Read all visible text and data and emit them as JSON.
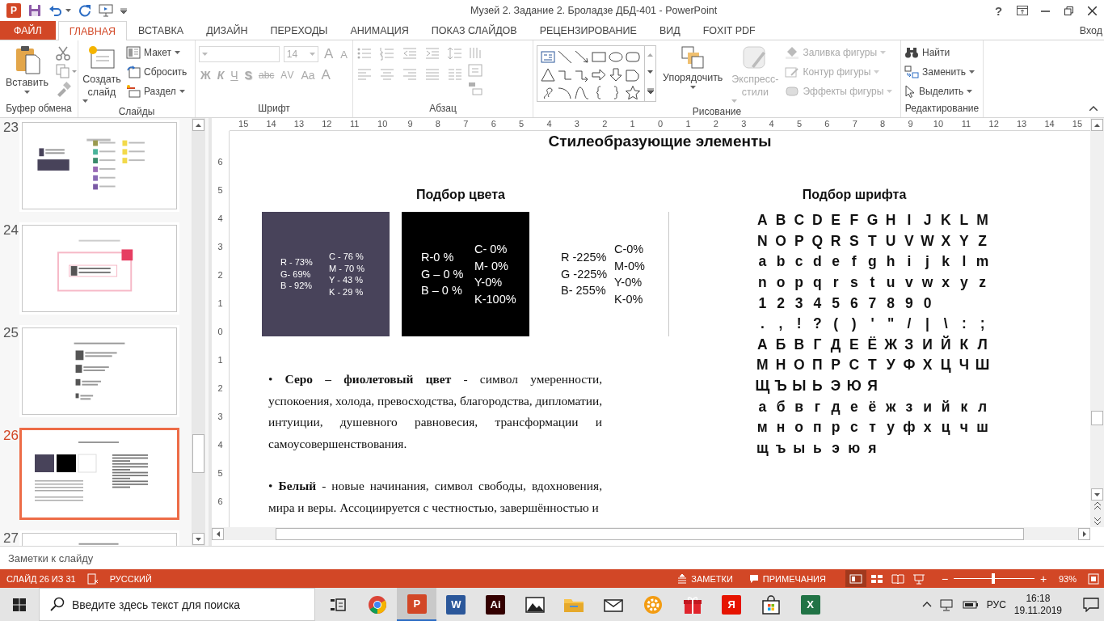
{
  "window": {
    "app_icon": "P",
    "title": "Музей 2. Задание 2. Броладзе ДБД-401 - PowerPoint",
    "help": "?"
  },
  "quick_access": [
    {
      "kind": "save"
    },
    {
      "kind": "undo"
    },
    {
      "kind": "redo"
    },
    {
      "kind": "slideshow"
    },
    {
      "kind": "customize"
    }
  ],
  "tabs": [
    {
      "label": "ФАЙЛ",
      "kind": "file",
      "selected": false
    },
    {
      "label": "ГЛАВНАЯ",
      "kind": "tab",
      "selected": true
    },
    {
      "label": "ВСТАВКА",
      "kind": "tab",
      "selected": false
    },
    {
      "label": "ДИЗАЙН",
      "kind": "tab",
      "selected": false
    },
    {
      "label": "ПЕРЕХОДЫ",
      "kind": "tab",
      "selected": false
    },
    {
      "label": "АНИМАЦИЯ",
      "kind": "tab",
      "selected": false
    },
    {
      "label": "ПОКАЗ СЛАЙДОВ",
      "kind": "tab",
      "selected": false
    },
    {
      "label": "РЕЦЕНЗИРОВАНИЕ",
      "kind": "tab",
      "selected": false
    },
    {
      "label": "ВИД",
      "kind": "tab",
      "selected": false
    },
    {
      "label": "FOXIT PDF",
      "kind": "tab",
      "selected": false
    }
  ],
  "account": "Вход",
  "ribbon": {
    "clipboard": {
      "label": "Буфер обмена",
      "paste": "Вставить"
    },
    "slides": {
      "label": "Слайды",
      "new_slide": "Создать слайд",
      "items": [
        {
          "label": "Макет",
          "kind": "layout",
          "dropdown": true
        },
        {
          "label": "Сбросить",
          "kind": "reset",
          "dropdown": false
        },
        {
          "label": "Раздел",
          "kind": "section",
          "dropdown": true
        }
      ]
    },
    "font": {
      "label": "Шрифт",
      "disabled": true,
      "size": "14",
      "size_buttons": [
        {
          "label": "A",
          "kind": "grow"
        },
        {
          "label": "A",
          "kind": "shrink"
        }
      ],
      "style_buttons": [
        {
          "label": "Ж",
          "kind": "bold"
        },
        {
          "label": "К",
          "kind": "italic"
        },
        {
          "label": "Ч",
          "kind": "underline"
        },
        {
          "label": "S",
          "kind": "shadow"
        },
        {
          "label": "abc",
          "kind": "strike"
        },
        {
          "label": "AV",
          "kind": "spacing"
        },
        {
          "label": "Aa",
          "kind": "case"
        },
        {
          "label": "A",
          "kind": "color"
        }
      ]
    },
    "paragraph": {
      "label": "Абзац",
      "disabled": true
    },
    "drawing": {
      "label": "Рисование",
      "arrange": "Упорядочить",
      "quick_styles": {
        "label": "Экспресс-стили",
        "disabled": true
      },
      "items": [
        {
          "label": "Заливка фигуры",
          "kind": "fill",
          "disabled": true
        },
        {
          "label": "Контур фигуры",
          "kind": "outline",
          "disabled": true
        },
        {
          "label": "Эффекты фигуры",
          "kind": "effects",
          "disabled": true
        }
      ]
    },
    "editing": {
      "label": "Редактирование",
      "items": [
        {
          "label": "Найти",
          "kind": "find",
          "dropdown": false
        },
        {
          "label": "Заменить",
          "kind": "replace",
          "dropdown": true
        },
        {
          "label": "Выделить",
          "kind": "select",
          "dropdown": true
        }
      ]
    }
  },
  "slide_thumbnails": [
    {
      "number": "23",
      "kind": "palette",
      "selected": false
    },
    {
      "number": "24",
      "kind": "logo-frame",
      "selected": false
    },
    {
      "number": "25",
      "kind": "logo-sizes",
      "selected": false
    },
    {
      "number": "26",
      "kind": "style",
      "selected": true
    },
    {
      "number": "27",
      "kind": "document",
      "selected": false
    }
  ],
  "horizontal_ruler": [
    "15",
    "14",
    "13",
    "12",
    "11",
    "10",
    "9",
    "8",
    "7",
    "6",
    "5",
    "4",
    "3",
    "2",
    "1",
    "0",
    "1",
    "2",
    "3",
    "4",
    "5",
    "6",
    "7",
    "8",
    "9",
    "10",
    "11",
    "12",
    "13",
    "14",
    "15"
  ],
  "vertical_ruler": [
    "6",
    "5",
    "4",
    "3",
    "2",
    "1",
    "0",
    "1",
    "2",
    "3",
    "4",
    "5",
    "6"
  ],
  "slide": {
    "title": "Стилеобразующие элементы",
    "color_section": {
      "heading": "Подбор цвета",
      "swatches": [
        {
          "kind": "dark",
          "color": "#48435a",
          "compact": true,
          "rgb": [
            "R - 73%",
            "G- 69%",
            "B - 92%"
          ],
          "cmyk": [
            "C - 76 %",
            "M - 70 %",
            "Y - 43 %",
            "K - 29 %"
          ]
        },
        {
          "kind": "dark",
          "color": "#000000",
          "compact": false,
          "rgb": [
            "R-0 %",
            "G – 0 %",
            "B – 0 %"
          ],
          "cmyk": [
            "C- 0%",
            "M- 0%",
            "Y-0%",
            "K-100%"
          ]
        },
        {
          "kind": "light",
          "color": "#ffffff",
          "compact": false,
          "rgb": [
            "R -225%",
            "G -225%",
            "B- 255%"
          ],
          "cmyk": [
            "C-0%",
            "M-0%",
            "Y-0%",
            "K-0%"
          ]
        }
      ]
    },
    "paragraphs": [
      "• **Серо – фиолетовый цвет** -  символ умеренности, успокоения, холода, превосходства, благородства, дипломатии, интуиции, душевного равновесия, трансформации и самоусовершенствования.",
      "• **Белый** - новые начинания, символ свободы, вдохновения, мира и веры. Ассоциируется с честностью, завершённостью и"
    ],
    "font_section": {
      "heading": "Подбор шрифта",
      "rows": [
        "A B C D E F G H I J K L M",
        "N O P Q R S T U V W X Y Z",
        "a b c d e f g h i j k l m",
        "n o p q r s t u v w x y z",
        "1 2 3 4 5 6 7 8 9 0",
        ". , ! ? ( ) ' \" / | \\ : ;",
        "А Б В Г Д Е Ё Ж З И Й К Л",
        "М Н О П Р С Т У Ф Х Ц Ч Ш",
        "Щ Ъ Ы Ь Э Ю Я",
        "а б в г д е ё ж з и й к л",
        "м н о п р с т у ф х ц ч ш",
        "щ ъ ы ь э ю я"
      ]
    }
  },
  "notes": {
    "placeholder": "Заметки к слайду"
  },
  "status": {
    "slide": "СЛАЙД 26 ИЗ 31",
    "language": "РУССКИЙ",
    "notes": "ЗАМЕТКИ",
    "comments": "ПРИМЕЧАНИЯ",
    "views": [
      {
        "kind": "normal",
        "selected": true
      },
      {
        "kind": "sorter",
        "selected": false
      },
      {
        "kind": "reading",
        "selected": false
      },
      {
        "kind": "slideshow",
        "selected": false
      }
    ],
    "zoom_out": "−",
    "zoom": {
      "level": 0.49
    },
    "zoom_in": "+",
    "zoom_value": "93%"
  },
  "taskbar": {
    "search": {
      "placeholder": "Введите здесь текст для поиска"
    },
    "apps": [
      {
        "kind": "task-view",
        "selected": false
      },
      {
        "kind": "chrome",
        "selected": false
      },
      {
        "kind": "tile",
        "label": "P",
        "color": "#d24726",
        "selected": true
      },
      {
        "kind": "tile",
        "label": "W",
        "color": "#2b579a",
        "selected": false
      },
      {
        "kind": "tile",
        "label": "Ai",
        "color": "#330000",
        "selected": false
      },
      {
        "kind": "photos",
        "selected": false
      },
      {
        "kind": "folder",
        "selected": false
      },
      {
        "kind": "mail",
        "selected": false
      },
      {
        "kind": "gear",
        "selected": false
      },
      {
        "kind": "gift",
        "selected": false
      },
      {
        "kind": "tile",
        "label": "Я",
        "color": "#e61400",
        "selected": false
      },
      {
        "kind": "store",
        "selected": false
      },
      {
        "kind": "tile",
        "label": "X",
        "color": "#217346",
        "selected": false
      }
    ],
    "language": "РУС",
    "time": "16:18",
    "date": "19.11.2019"
  }
}
